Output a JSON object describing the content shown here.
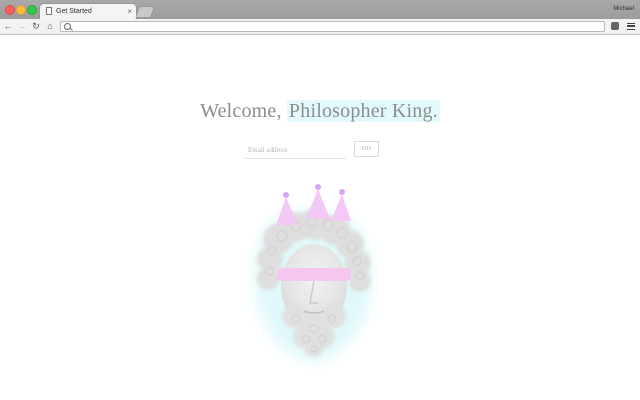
{
  "browser": {
    "tab_title": "Get Started",
    "tab_close": "×",
    "profile_name": "Michael",
    "omnibox_value": ""
  },
  "toolbar": {
    "back_icon": "←",
    "forward_icon": "→",
    "reload_icon": "↻",
    "home_icon": "⌂"
  },
  "page": {
    "welcome_prefix": "Welcome,",
    "welcome_name": "Philosopher King.",
    "email_placeholder": "Email address",
    "go_label": "GO"
  },
  "colors": {
    "name_highlight": "#e3fafc",
    "crown_pink": "#f3c6f5",
    "glow_cyan": "#dff8fb",
    "visor_pink": "#f7c4ef"
  }
}
